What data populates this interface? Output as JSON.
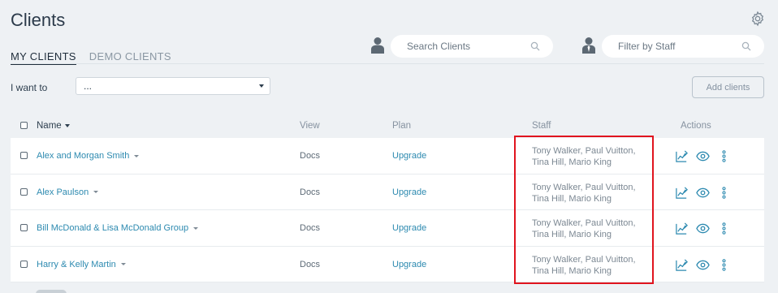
{
  "page": {
    "title": "Clients"
  },
  "tabs": [
    {
      "label": "MY CLIENTS",
      "active": true
    },
    {
      "label": "DEMO CLIENTS",
      "active": false
    }
  ],
  "search_clients": {
    "placeholder": "Search Clients",
    "icon": "search-icon"
  },
  "filter_staff": {
    "placeholder": "Filter by Staff",
    "icon": "search-icon"
  },
  "bulk": {
    "label": "I want to",
    "value": "..."
  },
  "add_button": {
    "label": "Add clients"
  },
  "table": {
    "headers": {
      "name": "Name",
      "view": "View",
      "plan": "Plan",
      "staff": "Staff",
      "actions": "Actions"
    },
    "rows": [
      {
        "name": "Alex and Morgan Smith",
        "view": "Docs",
        "plan": "Upgrade",
        "staff_line1": "Tony Walker, Paul Vuitton,",
        "staff_line2": "Tina Hill, Mario King"
      },
      {
        "name": "Alex Paulson",
        "view": "Docs",
        "plan": "Upgrade",
        "staff_line1": "Tony Walker, Paul Vuitton,",
        "staff_line2": "Tina Hill, Mario King"
      },
      {
        "name": "Bill McDonald & Lisa McDonald Group",
        "view": "Docs",
        "plan": "Upgrade",
        "staff_line1": "Tony Walker, Paul Vuitton,",
        "staff_line2": "Tina Hill, Mario King"
      },
      {
        "name": "Harry & Kelly Martin",
        "view": "Docs",
        "plan": "Upgrade",
        "staff_line1": "Tony Walker, Paul Vuitton,",
        "staff_line2": "Tina Hill, Mario King"
      }
    ],
    "row_actions": [
      "report-chart-icon",
      "eye-icon",
      "more-vertical-icon"
    ]
  },
  "colors": {
    "background": "#eef1f4",
    "link": "#2d8ab0",
    "highlight": "#e0141e"
  }
}
